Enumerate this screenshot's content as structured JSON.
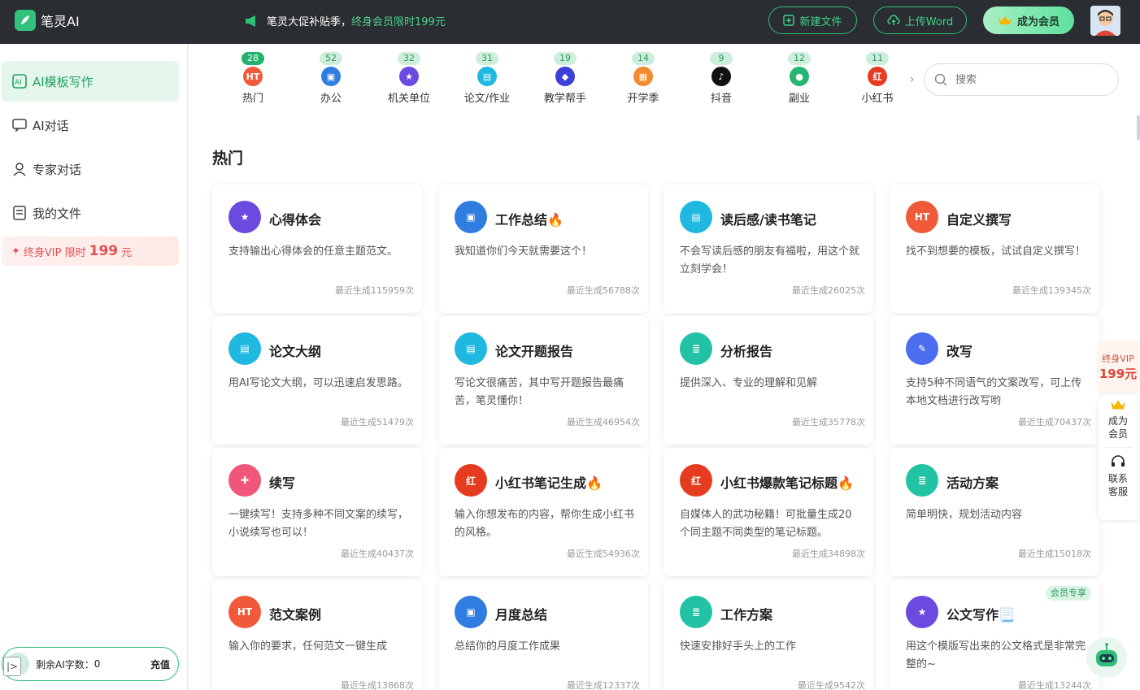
{
  "app": {
    "name": "笔灵AI"
  },
  "promo": {
    "text": "笔灵大促补贴季，",
    "highlight": "终身会员限时199元"
  },
  "topbar": {
    "new_file": "新建文件",
    "upload_word": "上传Word",
    "become_member": "成为会员"
  },
  "sidebar": {
    "items": [
      {
        "label": "AI模板写作",
        "icon": "ai-template-icon",
        "active": true
      },
      {
        "label": "AI对话",
        "icon": "chat-icon"
      },
      {
        "label": "专家对话",
        "icon": "expert-icon"
      },
      {
        "label": "我的文件",
        "icon": "file-icon"
      }
    ],
    "vip": {
      "text": "终身VIP 限时",
      "price": "199",
      "unit": "元"
    },
    "wordcount": {
      "label": "剩余AI字数：",
      "value": "0",
      "recharge": "充值"
    }
  },
  "categories": [
    {
      "label": "热门",
      "count": "28",
      "color": "#f05a3a",
      "glyph": "HT"
    },
    {
      "label": "办公",
      "count": "52",
      "color": "#2f7de1",
      "glyph": "▣"
    },
    {
      "label": "机关单位",
      "count": "32",
      "color": "#6b4ae0",
      "glyph": "★"
    },
    {
      "label": "论文/作业",
      "count": "31",
      "color": "#1fb8e0",
      "glyph": "▤"
    },
    {
      "label": "教学帮手",
      "count": "19",
      "color": "#3d3fd6",
      "glyph": "◆"
    },
    {
      "label": "开学季",
      "count": "14",
      "color": "#f28a2e",
      "glyph": "▦"
    },
    {
      "label": "抖音",
      "count": "9",
      "color": "#111111",
      "glyph": "♪"
    },
    {
      "label": "副业",
      "count": "12",
      "color": "#25b573",
      "glyph": "●"
    },
    {
      "label": "小红书",
      "count": "11",
      "color": "#e53b1f",
      "glyph": "红"
    }
  ],
  "search": {
    "placeholder": "搜索"
  },
  "section": {
    "title": "热门"
  },
  "cards": [
    {
      "title": "心得体会",
      "desc": "支持输出心得体会的任意主题范文。",
      "count": "最近生成115959次",
      "color": "#6b4ae0",
      "glyph": "★"
    },
    {
      "title": "工作总结🔥",
      "desc": "我知道你们今天就需要这个！",
      "count": "最近生成56788次",
      "color": "#2f7de1",
      "glyph": "▣"
    },
    {
      "title": "读后感/读书笔记",
      "desc": "不会写读后感的朋友有福啦，用这个就立刻学会！",
      "count": "最近生成26025次",
      "color": "#1fb8e0",
      "glyph": "▤"
    },
    {
      "title": "自定义撰写",
      "desc": "找不到想要的模板，试试自定义撰写！",
      "count": "最近生成139345次",
      "color": "#f05a3a",
      "glyph": "HT"
    },
    {
      "title": "论文大纲",
      "desc": "用AI写论文大纲，可以迅速启发思路。",
      "count": "最近生成51479次",
      "color": "#1fb8e0",
      "glyph": "▤"
    },
    {
      "title": "论文开题报告",
      "desc": "写论文很痛苦，其中写开题报告最痛苦，笔灵懂你！",
      "count": "最近生成46954次",
      "color": "#1fb8e0",
      "glyph": "▤"
    },
    {
      "title": "分析报告",
      "desc": "提供深入、专业的理解和见解",
      "count": "最近生成35778次",
      "color": "#22c3a4",
      "glyph": "≣"
    },
    {
      "title": "改写",
      "desc": "支持5种不同语气的文案改写，可上传本地文档进行改写哟",
      "count": "最近生成70437次",
      "color": "#4b6ef0",
      "glyph": "✎"
    },
    {
      "title": "续写",
      "desc": "一键续写！支持多种不同文案的续写，小说续写也可以！",
      "count": "最近生成40437次",
      "color": "#f0567a",
      "glyph": "✚"
    },
    {
      "title": "小红书笔记生成🔥",
      "desc": "输入你想发布的内容，帮你生成小红书的风格。",
      "count": "最近生成54936次",
      "color": "#e53b1f",
      "glyph": "红"
    },
    {
      "title": "小红书爆款笔记标题🔥",
      "desc": "自媒体人的武功秘籍！可批量生成20个同主题不同类型的笔记标题。",
      "count": "最近生成34898次",
      "color": "#e53b1f",
      "glyph": "红"
    },
    {
      "title": "活动方案",
      "desc": "简单明快，规划活动内容",
      "count": "最近生成15018次",
      "color": "#22c3a4",
      "glyph": "≣"
    },
    {
      "title": "范文案例",
      "desc": "输入你的要求，任何范文一键生成",
      "count": "最近生成13868次",
      "color": "#f05a3a",
      "glyph": "HT"
    },
    {
      "title": "月度总结",
      "desc": "总结你的月度工作成果",
      "count": "最近生成12337次",
      "color": "#2f7de1",
      "glyph": "▣"
    },
    {
      "title": "工作方案",
      "desc": "快速安排好手头上的工作",
      "count": "最近生成9542次",
      "color": "#22c3a4",
      "glyph": "≣"
    },
    {
      "title": "公文写作📃",
      "desc": "用这个模版写出来的公文格式是非常完整的~",
      "count": "最近生成13244次",
      "color": "#6b4ae0",
      "glyph": "★",
      "badge": "会员专享"
    }
  ],
  "float": {
    "vip_l1": "终身VIP",
    "vip_l2": "199元",
    "member_1": "成为",
    "member_2": "会员",
    "service_1": "联系",
    "service_2": "客服"
  }
}
